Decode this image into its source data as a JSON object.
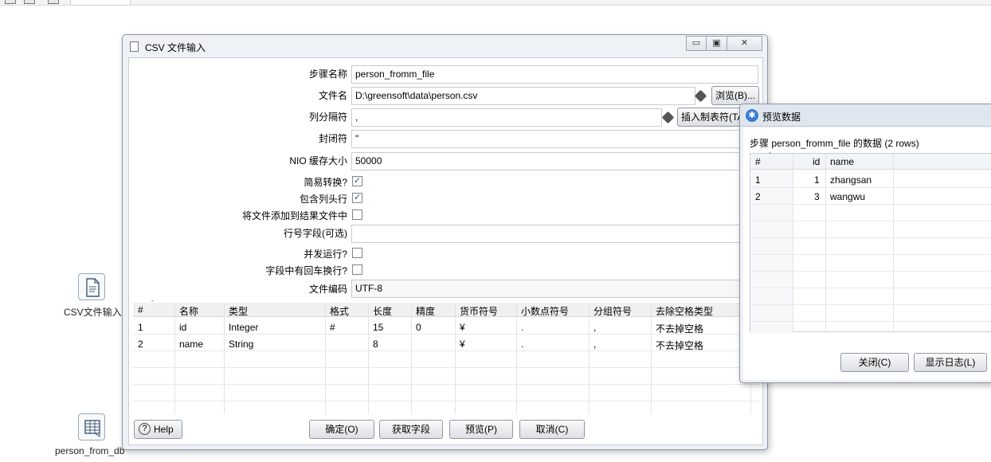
{
  "canvas": {
    "steps": [
      {
        "label": "CSV文件输入",
        "icon": "file-input-icon"
      },
      {
        "label": "person_from_db",
        "icon": "table-input-icon"
      }
    ]
  },
  "dialog": {
    "title": "CSV 文件输入",
    "window_buttons": {
      "minimize": "▭",
      "maximize": "▣",
      "close": "✕"
    },
    "labels": {
      "step_name": "步骤名称",
      "file_name": "文件名",
      "delimiter": "列分隔符",
      "enclosure": "封闭符",
      "nio_buffer": "NIO 缓存大小",
      "lazy_conversion": "简易转换?",
      "header_present": "包含列头行",
      "add_to_result": "将文件添加到结果文件中",
      "row_number_field": "行号字段(可选)",
      "parallel": "并发运行?",
      "newline_in_fields": "字段中有回车换行?",
      "encoding": "文件编码"
    },
    "values": {
      "step_name": "person_fromm_file",
      "file_name": "D:\\greensoft\\data\\person.csv",
      "delimiter": ",",
      "enclosure": "\"",
      "nio_buffer": "50000",
      "row_number_field": "",
      "encoding": "UTF-8"
    },
    "checks": {
      "lazy_conversion": "✓",
      "header_present": "✓",
      "add_to_result": "",
      "parallel": "",
      "newline_in_fields": ""
    },
    "buttons": {
      "browse": "浏览(B)...",
      "insert_tab": "插入制表符(TAB)",
      "help": "Help",
      "ok": "确定(O)",
      "get_fields": "获取字段",
      "preview": "预览(P)",
      "cancel": "取消(C)"
    },
    "fields_table": {
      "columns": [
        "#",
        "名称",
        "类型",
        "格式",
        "长度",
        "精度",
        "货币符号",
        "小数点符号",
        "分组符号",
        "去除空格类型"
      ],
      "rows": [
        [
          "1",
          "id",
          "Integer",
          "#",
          "15",
          "0",
          "¥",
          ".",
          ",",
          "不去掉空格"
        ],
        [
          "2",
          "name",
          "String",
          "",
          "8",
          "",
          "¥",
          ".",
          ",",
          "不去掉空格"
        ]
      ]
    }
  },
  "preview": {
    "title": "预览数据",
    "subtitle": "步骤 person_fromm_file 的数据  (2 rows)",
    "columns": [
      "#",
      "id",
      "name"
    ],
    "rows": [
      [
        "1",
        "1",
        "zhangsan"
      ],
      [
        "2",
        "3",
        "wangwu"
      ]
    ],
    "buttons": {
      "close": "关闭(C)",
      "show_log": "显示日志(L)"
    }
  }
}
